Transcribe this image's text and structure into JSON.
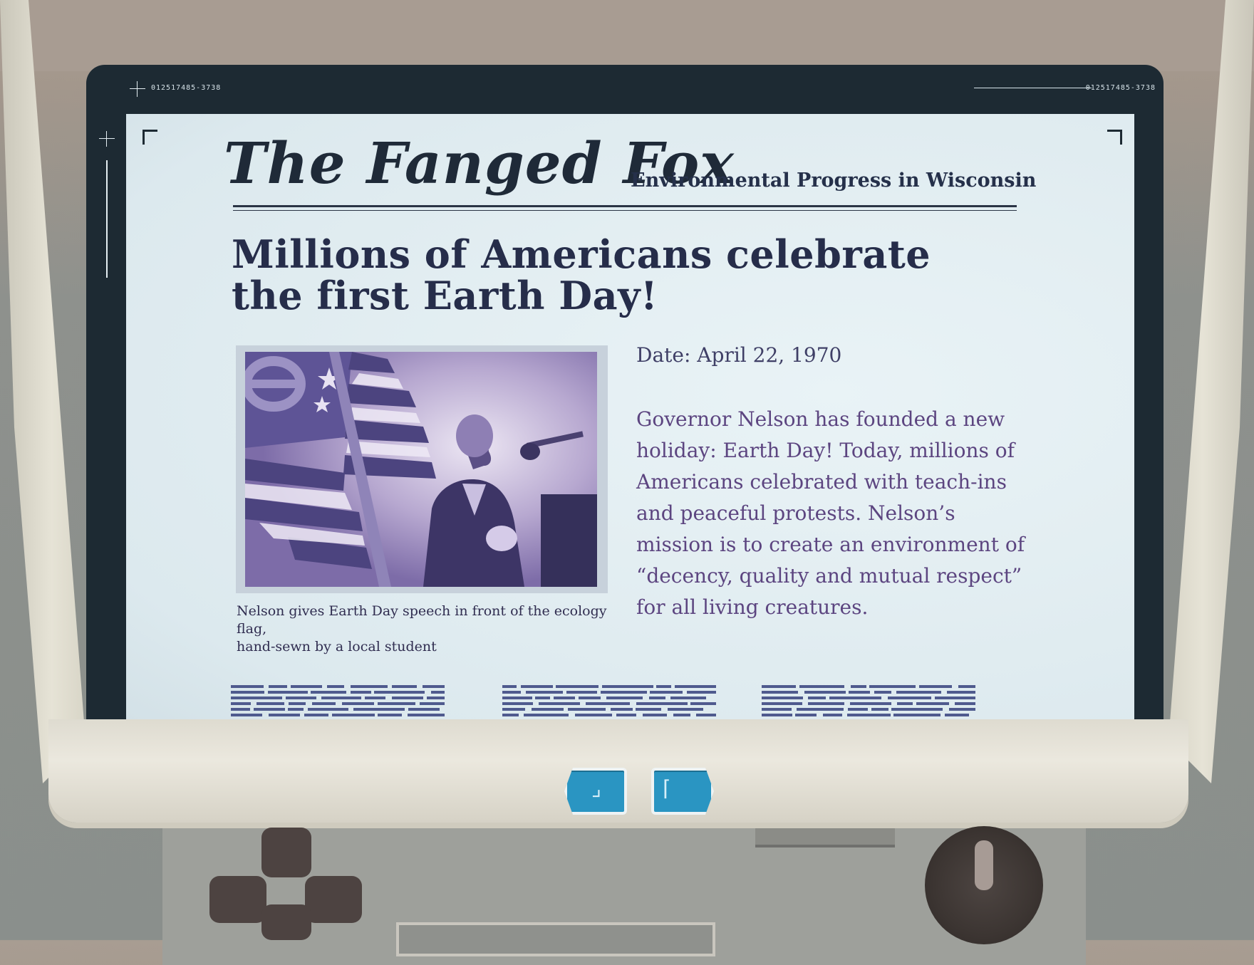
{
  "screen": {
    "id_left": "012517485-3738",
    "id_right": "012517485-3738"
  },
  "newspaper": {
    "masthead": "The Fanged Fox",
    "section": "Environmental Progress in Wisconsin",
    "headline_line1": "Millions of Americans celebrate",
    "headline_line2": "the first Earth Day!",
    "date": "Date: April 22, 1970",
    "body": "Governor Nelson has founded a new holiday: Earth Day! Today, millions of Americans celebrated with teach-ins and peaceful protests. Nelson’s mission is to create an environment of “decency, quality and mutual respect” for all living creatures.",
    "caption_line1": "Nelson gives Earth Day speech in front of the ecology flag,",
    "caption_line2": "hand-sewn by a local student",
    "photo_icon": "speech-photo"
  },
  "navigation": {
    "prev_icon": "prev-page-icon",
    "next_icon": "next-page-icon"
  },
  "colors": {
    "screen_frame": "#1d2a33",
    "paper": "#e3eef2",
    "masthead": "#1f2a38",
    "body_text": "#5c4580",
    "nav_button": "#2a95c2"
  }
}
